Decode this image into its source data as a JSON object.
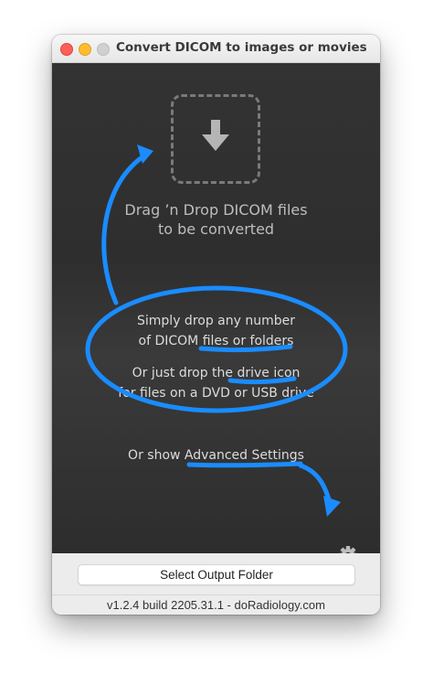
{
  "window": {
    "title": "Convert DICOM to images or movies"
  },
  "drop_area": {
    "title_line1": "Drag ’n Drop DICOM files",
    "title_line2": "to be converted",
    "drop_icon": "download-arrow-icon"
  },
  "hints": {
    "line1": "Simply drop any number",
    "line2": "of DICOM files or folders",
    "line3": "Or just drop the drive icon",
    "line4": "for files on a DVD or USB drive",
    "advanced": "Or show Advanced Settings",
    "accent_color": "#1a8cff"
  },
  "settings": {
    "icon": "gear-icon"
  },
  "actions": {
    "select_output_folder": "Select Output Folder"
  },
  "status": {
    "version": "v1.2.4 build 2205.31.1 - doRadiology.com"
  }
}
